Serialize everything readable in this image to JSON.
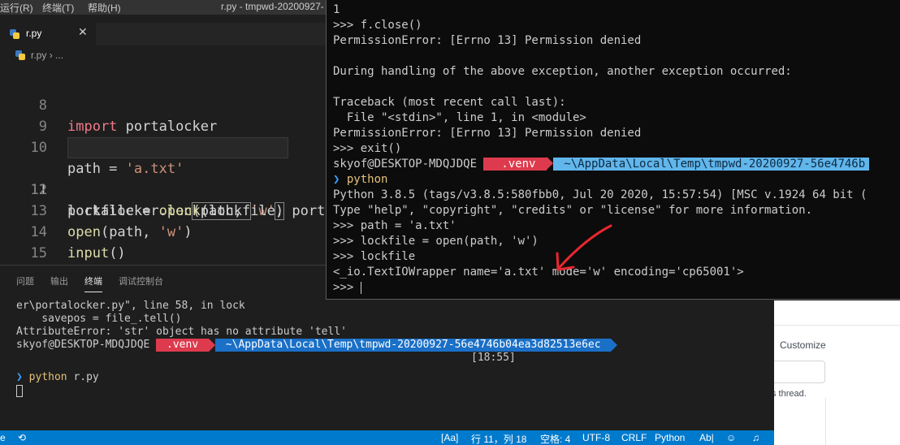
{
  "titlebar": {
    "menu": [
      "运行(R)",
      "终端(T)",
      "帮助(H)"
    ],
    "title": "r.py - tmpwd-20200927-"
  },
  "tab": {
    "label": "r.py",
    "close": "✕"
  },
  "breadcrumb": {
    "file": "r.py",
    "sep": "›",
    "more": "..."
  },
  "editor": {
    "lines": [
      {
        "n": "8"
      },
      {
        "n": "9"
      },
      {
        "n": "10"
      },
      {
        "n": "11"
      },
      {
        "n": "12"
      },
      {
        "n": "13"
      },
      {
        "n": "14"
      },
      {
        "n": "15"
      }
    ],
    "code": {
      "l8_kw": "import",
      "l8_mod": " portalocker",
      "l10_var": "path = ",
      "l10_str": "'a.txt'",
      "l11_var": "lockfile = ",
      "l11_fn": "open",
      "l11_a": "(path, ",
      "l11_str": "'w'",
      "l11_b": ")",
      "l12_var": "portalocker.",
      "l12_fn": "lock",
      "l12_a": "(lockfile, port",
      "l13_fn": "open",
      "l13_a": "(path, ",
      "l13_str": "'w'",
      "l13_b": ")",
      "l14_fn": "input",
      "l14_a": "()"
    }
  },
  "panel": {
    "tabs": [
      "问题",
      "输出",
      "终端",
      "调试控制台"
    ],
    "terminal": {
      "l1": "er\\portalocker.py\", line 58, in lock",
      "l2": "    savepos = file_.tell()",
      "l3": "AttributeError: 'str' object has no attribute 'tell'",
      "user": "skyof@DESKTOP-MDQJDQE ",
      "venv": " .venv ",
      "path": " ~\\AppData\\Local\\Temp\\tmpwd-20200927-56e4746b04ea3d82513e6ec ",
      "time": "[18:55]",
      "chev": "❯",
      "cmd_kw": "python",
      "cmd_arg": " r.py"
    }
  },
  "statusbar": {
    "left": "e",
    "aa": "[Aa]",
    "pos": "行 11，列 18",
    "spaces": "空格: 4",
    "enc": "UTF-8",
    "eol": "CRLF",
    "lang": "Python",
    "ab": "Ab|"
  },
  "wt": {
    "lines": [
      "1",
      ">>> f.close()",
      "PermissionError: [Errno 13] Permission denied",
      "",
      "During handling of the above exception, another exception occurred:",
      "",
      "Traceback (most recent call last):",
      "  File \"<stdin>\", line 1, in <module>",
      "PermissionError: [Errno 13] Permission denied",
      ">>> exit()"
    ],
    "user": "skyof@DESKTOP-MDQJDQE ",
    "venv": "  .venv ",
    "path": " ~\\AppData\\Local\\Temp\\tmpwd-20200927-56e4746b",
    "chev": "❯",
    "cmd": "python",
    "lines2": [
      "Python 3.8.5 (tags/v3.8.5:580fbb0, Jul 20 2020, 15:57:54) [MSC v.1924 64 bit (",
      "Type \"help\", \"copyright\", \"credits\" or \"license\" for more information.",
      ">>> path = 'a.txt'",
      ">>> lockfile = open(path, 'w')",
      ">>> lockfile",
      "<_io.TextIOWrapper name='a.txt' mode='w' encoding='cp65001'>"
    ],
    "prompt": ">>> "
  },
  "webpage": {
    "customize": "Customize",
    "thread": "s thread."
  },
  "colors": {
    "accent": "#007acc",
    "annotation": "#e8272f",
    "venv": "#dd3b4d",
    "path": "#1a6fc6"
  }
}
